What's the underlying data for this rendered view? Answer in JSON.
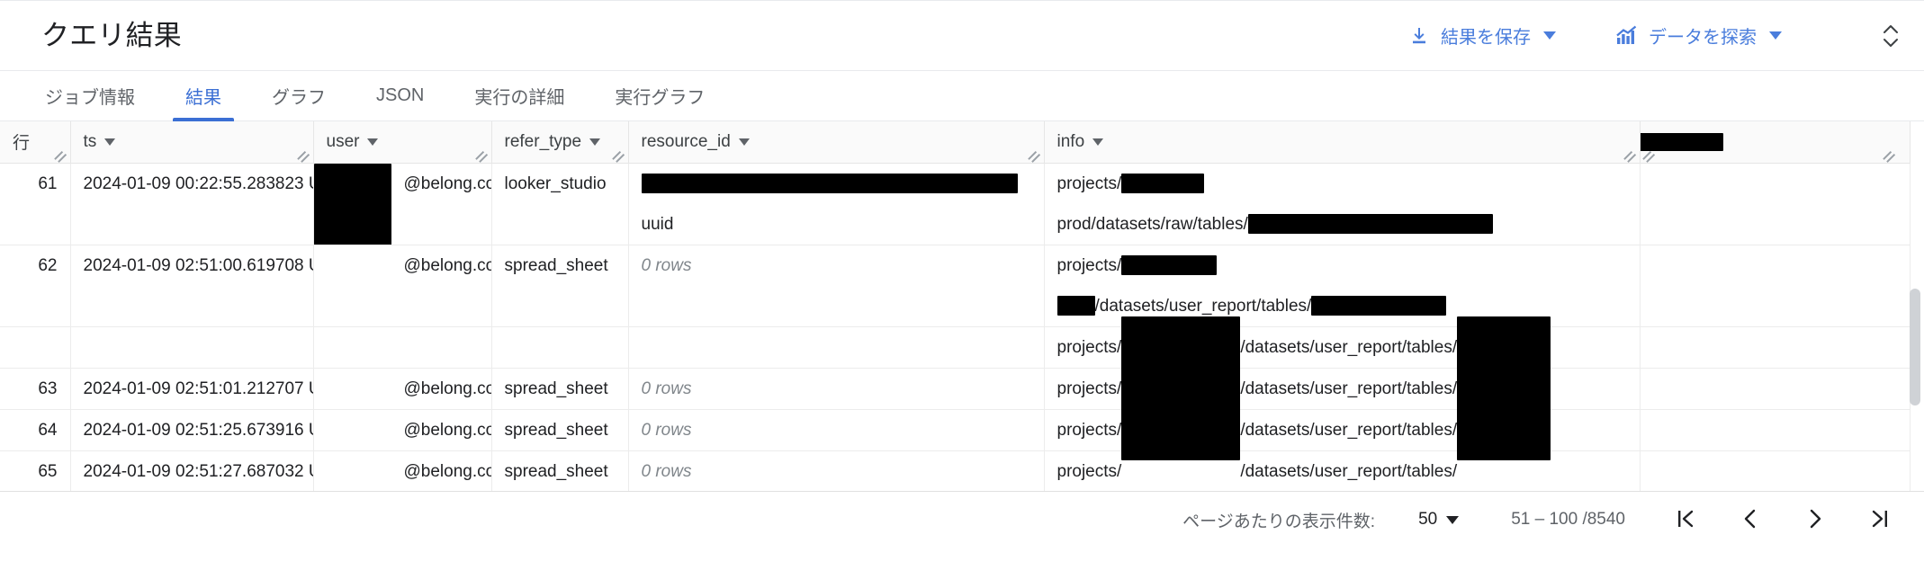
{
  "header": {
    "title": "クエリ結果",
    "save_results_label": "結果を保存",
    "explore_data_label": "データを探索",
    "accent_color": "#4a7ddc"
  },
  "tabs": [
    {
      "label": "ジョブ情報",
      "active": false
    },
    {
      "label": "結果",
      "active": true
    },
    {
      "label": "グラフ",
      "active": false
    },
    {
      "label": "JSON",
      "active": false
    },
    {
      "label": "実行の詳細",
      "active": false
    },
    {
      "label": "実行グラフ",
      "active": false
    }
  ],
  "table": {
    "columns": [
      {
        "name": "行",
        "has_menu": false
      },
      {
        "name": "ts",
        "has_menu": true
      },
      {
        "name": "user",
        "has_menu": true
      },
      {
        "name": "refer_type",
        "has_menu": true
      },
      {
        "name": "resource_id",
        "has_menu": true
      },
      {
        "name": "info",
        "has_menu": true
      }
    ],
    "rows": [
      {
        "row": "61",
        "ts": "2024-01-09 00:22:55.283823 U…",
        "user_suffix": "@belong.co.jp",
        "refer_type": "looker_studio",
        "resource_id_line1": "",
        "resource_id_line2": "uuid",
        "info_line1": "projects/",
        "info_line2": "prod/datasets/raw/tables/",
        "tall": true
      },
      {
        "row": "62",
        "ts": "2024-01-09 02:51:00.619708 U…",
        "user_suffix": "@belong.co.jp",
        "refer_type": "spread_sheet",
        "resource_id_line1": "0 rows",
        "resource_id_line2": "",
        "info_line1": "projects/",
        "info_line2": "/datasets/user_report/tables/",
        "tall": true
      },
      {
        "row": "",
        "ts": "",
        "user_suffix": "",
        "refer_type": "",
        "resource_id_line1": "",
        "resource_id_line2": "",
        "info_line1": "projects/",
        "info_line2": "/datasets/user_report/tables/",
        "tall": false
      },
      {
        "row": "63",
        "ts": "2024-01-09 02:51:01.212707 U…",
        "user_suffix": "@belong.co.jp",
        "refer_type": "spread_sheet",
        "resource_id_line1": "0 rows",
        "resource_id_line2": "",
        "info_line1": "projects/",
        "info_line2": "/datasets/user_report/tables/",
        "tall": false
      },
      {
        "row": "64",
        "ts": "2024-01-09 02:51:25.673916 U…",
        "user_suffix": "@belong.co.jp",
        "refer_type": "spread_sheet",
        "resource_id_line1": "0 rows",
        "resource_id_line2": "",
        "info_line1": "projects/",
        "info_line2": "/datasets/user_report/tables/",
        "tall": false
      },
      {
        "row": "65",
        "ts": "2024-01-09 02:51:27.687032 U…",
        "user_suffix": "@belong.co.jp",
        "refer_type": "spread_sheet",
        "resource_id_line1": "0 rows",
        "resource_id_line2": "",
        "info_line1": "projects/",
        "info_line2": "/datasets/user_report/tables/",
        "tall": false
      }
    ]
  },
  "pagination": {
    "rows_per_page_label": "ページあたりの表示件数:",
    "page_size": "50",
    "range_text": "51 – 100 /8540"
  }
}
